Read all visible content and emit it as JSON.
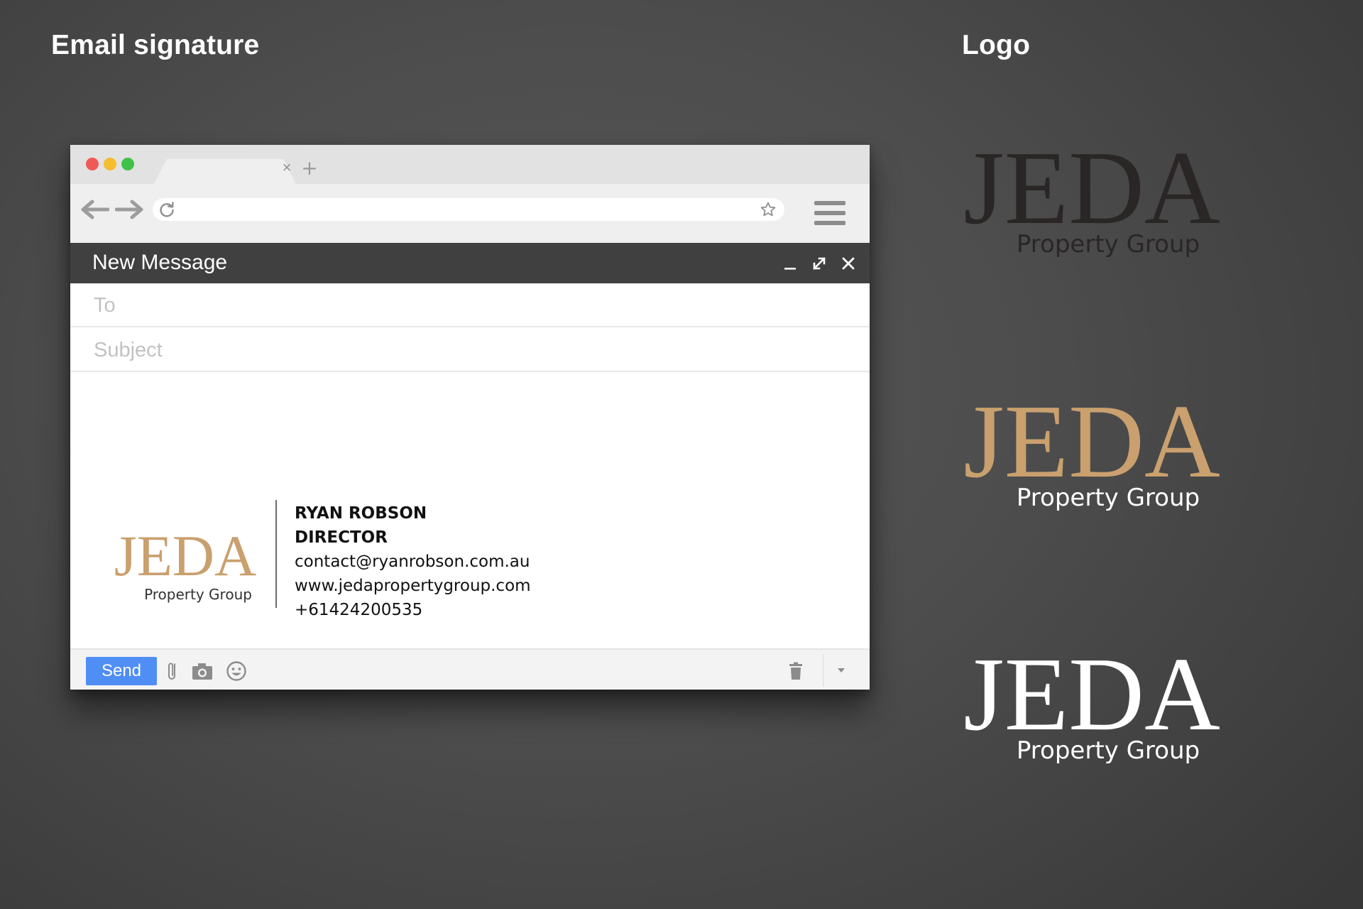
{
  "headings": {
    "email_signature": "Email signature",
    "logo": "Logo"
  },
  "browser": {
    "tab_close_glyph": "×",
    "new_tab_glyph": "+"
  },
  "compose": {
    "title": "New Message",
    "to_placeholder": "To",
    "subject_placeholder": "Subject",
    "send_label": "Send"
  },
  "signature": {
    "logo_wordmark": "JEDA",
    "logo_tagline": "Property Group",
    "name": "RYAN ROBSON",
    "role": "DIRECTOR",
    "email": "contact@ryanrobson.com.au",
    "website": "www.jedapropertygroup.com",
    "phone": "+61424200535"
  },
  "logos": [
    {
      "wordmark": "JEDA",
      "tagline": "Property Group",
      "wordmark_color": "#2a2626",
      "tagline_color": "#2a2626"
    },
    {
      "wordmark": "JEDA",
      "tagline": "Property Group",
      "wordmark_color": "#c9a06e",
      "tagline_color": "#ffffff"
    },
    {
      "wordmark": "JEDA",
      "tagline": "Property Group",
      "wordmark_color": "#ffffff",
      "tagline_color": "#ffffff"
    }
  ],
  "colors": {
    "brand_gold": "#c9a06e",
    "send_button": "#4f8ef4",
    "compose_header": "#404040"
  }
}
